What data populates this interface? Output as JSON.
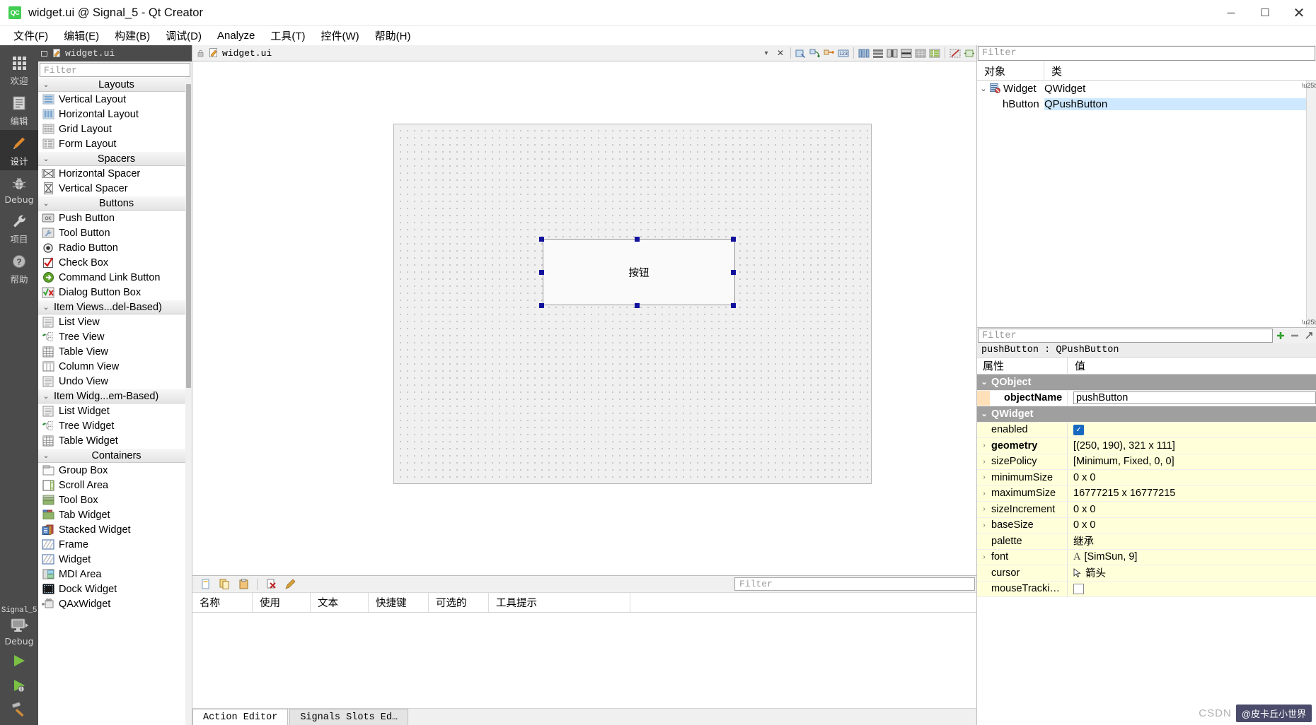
{
  "window": {
    "title": "widget.ui @ Signal_5 - Qt Creator",
    "app_icon": "QC",
    "minimize": "─",
    "maximize": "☐",
    "close": "✕"
  },
  "menubar": {
    "items": [
      {
        "label": "文件(F)"
      },
      {
        "label": "编辑(E)"
      },
      {
        "label": "构建(B)"
      },
      {
        "label": "调试(D)"
      },
      {
        "label": "Analyze"
      },
      {
        "label": "工具(T)"
      },
      {
        "label": "控件(W)"
      },
      {
        "label": "帮助(H)"
      }
    ]
  },
  "modebar": {
    "modes": [
      {
        "label": "欢迎",
        "icon": "grid-icon",
        "active": false
      },
      {
        "label": "编辑",
        "icon": "document-icon",
        "active": false
      },
      {
        "label": "设计",
        "icon": "pencil-icon",
        "active": true
      },
      {
        "label": "Debug",
        "icon": "bug-icon",
        "active": false
      },
      {
        "label": "项目",
        "icon": "wrench-icon",
        "active": false
      },
      {
        "label": "帮助",
        "icon": "question-icon",
        "active": false
      }
    ],
    "kit_name": "Signal_5",
    "build_config": "Debug",
    "run_icon": "run-play-icon",
    "debug_icon": "run-debug-icon",
    "build_icon": "hammer-icon"
  },
  "editor_toolbar": {
    "file_name": "widget.ui",
    "close_label": "✕",
    "dropdown_label": "▾",
    "tools": [
      {
        "name": "edit-widgets-icon"
      },
      {
        "name": "edit-signals-slots-icon"
      },
      {
        "name": "edit-buddies-icon"
      },
      {
        "name": "edit-tab-order-icon"
      },
      {
        "name": "layout-horizontal-icon"
      },
      {
        "name": "layout-vertical-icon"
      },
      {
        "name": "layout-splitter-h-icon"
      },
      {
        "name": "layout-splitter-v-icon"
      },
      {
        "name": "layout-grid-icon"
      },
      {
        "name": "layout-form-icon"
      },
      {
        "name": "break-layout-icon"
      },
      {
        "name": "adjust-size-icon"
      }
    ]
  },
  "widget_box": {
    "dock_title": "widget.ui",
    "filter_placeholder": "Filter",
    "groups": [
      {
        "name": "Layouts",
        "centered": true,
        "items": [
          {
            "label": "Vertical Layout",
            "icon": "vertical-layout-icon"
          },
          {
            "label": "Horizontal Layout",
            "icon": "horizontal-layout-icon"
          },
          {
            "label": "Grid Layout",
            "icon": "grid-layout-icon"
          },
          {
            "label": "Form Layout",
            "icon": "form-layout-icon"
          }
        ]
      },
      {
        "name": "Spacers",
        "centered": true,
        "items": [
          {
            "label": "Horizontal Spacer",
            "icon": "horizontal-spacer-icon"
          },
          {
            "label": "Vertical Spacer",
            "icon": "vertical-spacer-icon"
          }
        ]
      },
      {
        "name": "Buttons",
        "centered": true,
        "items": [
          {
            "label": "Push Button",
            "icon": "push-button-icon"
          },
          {
            "label": "Tool Button",
            "icon": "tool-button-icon"
          },
          {
            "label": "Radio Button",
            "icon": "radio-button-icon"
          },
          {
            "label": "Check Box",
            "icon": "check-box-icon"
          },
          {
            "label": "Command Link Button",
            "icon": "command-link-icon"
          },
          {
            "label": "Dialog Button Box",
            "icon": "dialog-button-box-icon"
          }
        ]
      },
      {
        "name": "Item Views...del-Based)",
        "centered": false,
        "items": [
          {
            "label": "List View",
            "icon": "list-view-icon"
          },
          {
            "label": "Tree View",
            "icon": "tree-view-icon"
          },
          {
            "label": "Table View",
            "icon": "table-view-icon"
          },
          {
            "label": "Column View",
            "icon": "column-view-icon"
          },
          {
            "label": "Undo View",
            "icon": "undo-view-icon"
          }
        ]
      },
      {
        "name": "Item Widg...em-Based)",
        "centered": false,
        "items": [
          {
            "label": "List Widget",
            "icon": "list-widget-icon"
          },
          {
            "label": "Tree Widget",
            "icon": "tree-widget-icon"
          },
          {
            "label": "Table Widget",
            "icon": "table-widget-icon"
          }
        ]
      },
      {
        "name": "Containers",
        "centered": true,
        "items": [
          {
            "label": "Group Box",
            "icon": "group-box-icon"
          },
          {
            "label": "Scroll Area",
            "icon": "scroll-area-icon"
          },
          {
            "label": "Tool Box",
            "icon": "tool-box-icon"
          },
          {
            "label": "Tab Widget",
            "icon": "tab-widget-icon"
          },
          {
            "label": "Stacked Widget",
            "icon": "stacked-widget-icon"
          },
          {
            "label": "Frame",
            "icon": "frame-icon"
          },
          {
            "label": "Widget",
            "icon": "widget-icon"
          },
          {
            "label": "MDI Area",
            "icon": "mdi-area-icon"
          },
          {
            "label": "Dock Widget",
            "icon": "dock-widget-icon"
          },
          {
            "label": "QAxWidget",
            "icon": "qax-widget-icon"
          }
        ]
      }
    ]
  },
  "form_canvas": {
    "button_text": "按钮",
    "selected": true
  },
  "action_editor": {
    "filter_placeholder": "Filter",
    "columns": [
      "名称",
      "使用",
      "文本",
      "快捷键",
      "可选的",
      "工具提示"
    ],
    "toolbar": [
      {
        "name": "new-action-icon"
      },
      {
        "name": "copy-action-icon"
      },
      {
        "name": "paste-action-icon"
      },
      {
        "name": "delete-action-icon"
      },
      {
        "name": "edit-action-icon"
      }
    ],
    "tabs": [
      {
        "label": "Action Editor",
        "active": true
      },
      {
        "label": "Signals  Slots Ed…",
        "active": false
      }
    ],
    "rows": []
  },
  "object_inspector": {
    "filter_placeholder": "Filter",
    "columns": [
      "对象",
      "类"
    ],
    "rows": [
      {
        "object": "Widget",
        "class": "QWidget",
        "level": 0,
        "expandable": true,
        "selected": false,
        "icon": "qwidget-icon"
      },
      {
        "object": "hButton",
        "class": "QPushButton",
        "level": 1,
        "expandable": false,
        "selected": true,
        "icon": ""
      }
    ]
  },
  "property_editor": {
    "filter_placeholder": "Filter",
    "object_header": "pushButton : QPushButton",
    "columns": [
      "属性",
      "值"
    ],
    "add_button": "+",
    "remove_button": "−",
    "config_button": "↗",
    "rows": [
      {
        "kind": "group",
        "name": "QObject"
      },
      {
        "kind": "prop",
        "name": "objectName",
        "value": "pushButton",
        "bold": true,
        "marker": "orange",
        "expandable": false,
        "editing": true
      },
      {
        "kind": "group",
        "name": "QWidget"
      },
      {
        "kind": "prop",
        "name": "enabled",
        "value": "",
        "bold": false,
        "marker": "yellow",
        "expandable": false,
        "checkbox": true
      },
      {
        "kind": "prop",
        "name": "geometry",
        "value": "[(250, 190), 321 x 111]",
        "bold": true,
        "marker": "yellow",
        "expandable": true
      },
      {
        "kind": "prop",
        "name": "sizePolicy",
        "value": "[Minimum, Fixed, 0, 0]",
        "bold": false,
        "marker": "yellow",
        "expandable": true
      },
      {
        "kind": "prop",
        "name": "minimumSize",
        "value": "0 x 0",
        "bold": false,
        "marker": "yellow",
        "expandable": true
      },
      {
        "kind": "prop",
        "name": "maximumSize",
        "value": "16777215 x 16777215",
        "bold": false,
        "marker": "yellow",
        "expandable": true
      },
      {
        "kind": "prop",
        "name": "sizeIncrement",
        "value": "0 x 0",
        "bold": false,
        "marker": "yellow",
        "expandable": true
      },
      {
        "kind": "prop",
        "name": "baseSize",
        "value": "0 x 0",
        "bold": false,
        "marker": "yellow",
        "expandable": true
      },
      {
        "kind": "prop",
        "name": "palette",
        "value": "继承",
        "bold": false,
        "marker": "yellow",
        "expandable": false
      },
      {
        "kind": "prop",
        "name": "font",
        "value": "[SimSun, 9]",
        "bold": false,
        "marker": "yellow",
        "expandable": true,
        "prefix": "A"
      },
      {
        "kind": "prop",
        "name": "cursor",
        "value": "箭头",
        "bold": false,
        "marker": "yellow",
        "expandable": false,
        "prefix": "cursor-arrow-icon"
      },
      {
        "kind": "prop",
        "name": "mouseTracki…",
        "value": "",
        "bold": false,
        "marker": "yellow",
        "expandable": false,
        "checkbox_empty": true
      }
    ]
  },
  "watermark": {
    "csdn": "CSDN",
    "badge": "@皮卡丘小世界"
  },
  "colors": {
    "accent_green": "#41cd52",
    "selection_blue": "#cde8ff",
    "group_gray": "#9f9f9f",
    "prop_yellow": "#ffffd9",
    "prop_orange": "#ffe0b8",
    "mode_bar": "#4b4b4b"
  }
}
